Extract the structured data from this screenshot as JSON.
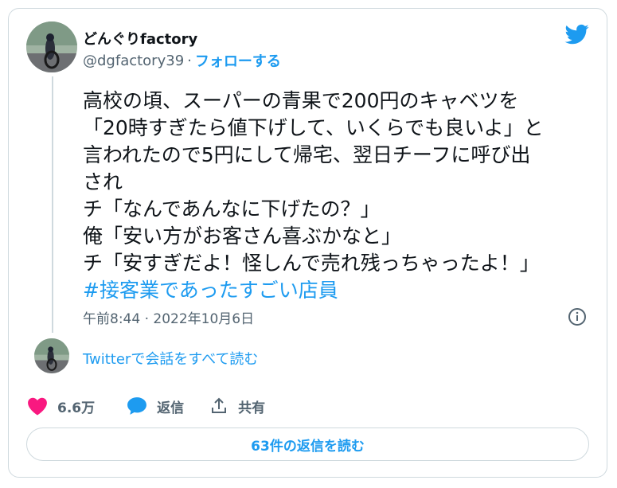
{
  "user": {
    "display_name": "どんぐりfactory",
    "handle": "@dgfactory39",
    "separator": "·",
    "follow_label": "フォローする"
  },
  "icons": {
    "brand": "twitter-bird-icon",
    "info": "info-icon",
    "like": "heart-icon",
    "reply": "speech-bubble-icon",
    "share": "share-icon"
  },
  "colors": {
    "accent": "#1d9bf0",
    "like": "#f91880",
    "muted": "#536471",
    "border": "#cfd9de"
  },
  "tweet": {
    "lines": [
      "高校の頃、スーパーの青果で200円のキャベツを",
      "「20時すぎたら値下げして、いくらでも良いよ」と",
      "言われたので5円にして帰宅、翌日チーフに呼び出",
      "され",
      "チ「なんであんなに下げたの？」",
      "俺「安い方がお客さん喜ぶかなと」",
      "チ「安すぎだよ！怪しんで売れ残っちゃったよ！」"
    ],
    "hashtag": "#接客業であったすごい店員",
    "timestamp": "午前8:44 · 2022年10月6日"
  },
  "conversation_link": "Twitterで会話をすべて読む",
  "actions": {
    "like_count": "6.6万",
    "reply_label": "返信",
    "share_label": "共有"
  },
  "read_replies_label": "63件の返信を読む"
}
